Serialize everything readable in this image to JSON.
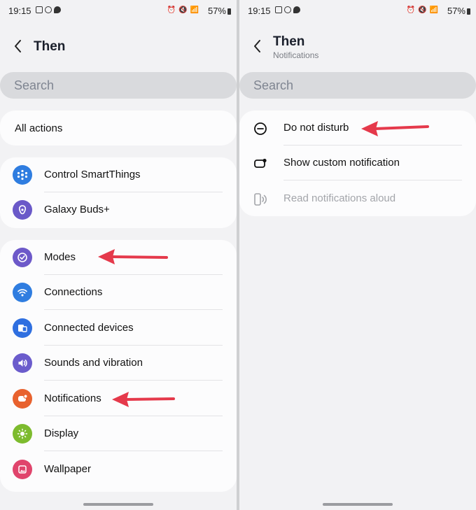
{
  "colors": {
    "arrow": "#e5394b",
    "accent_blue": "#3a7bea"
  },
  "left": {
    "status": {
      "time": "19:15",
      "battery": "57%"
    },
    "header": {
      "title": "Then"
    },
    "search": {
      "placeholder": "Search"
    },
    "all_actions": {
      "label": "All actions"
    },
    "group1": [
      {
        "label": "Control SmartThings",
        "icon": "smartthings-icon"
      },
      {
        "label": "Galaxy Buds+",
        "icon": "galaxy-buds-icon"
      }
    ],
    "group2": [
      {
        "label": "Modes",
        "icon": "modes-icon"
      },
      {
        "label": "Connections",
        "icon": "wifi-icon"
      },
      {
        "label": "Connected devices",
        "icon": "connected-devices-icon"
      },
      {
        "label": "Sounds and vibration",
        "icon": "speaker-icon"
      },
      {
        "label": "Notifications",
        "icon": "notification-icon"
      },
      {
        "label": "Display",
        "icon": "sun-icon"
      },
      {
        "label": "Wallpaper",
        "icon": "wallpaper-icon"
      }
    ]
  },
  "right": {
    "status": {
      "time": "19:15",
      "battery": "57%"
    },
    "header": {
      "title": "Then",
      "subtitle": "Notifications"
    },
    "search": {
      "placeholder": "Search"
    },
    "items": [
      {
        "label": "Do not disturb",
        "icon": "minus-circle-icon",
        "enabled": true
      },
      {
        "label": "Show custom notification",
        "icon": "notification-badge-icon",
        "enabled": true
      },
      {
        "label": "Read notifications aloud",
        "icon": "read-aloud-icon",
        "enabled": false
      }
    ]
  }
}
